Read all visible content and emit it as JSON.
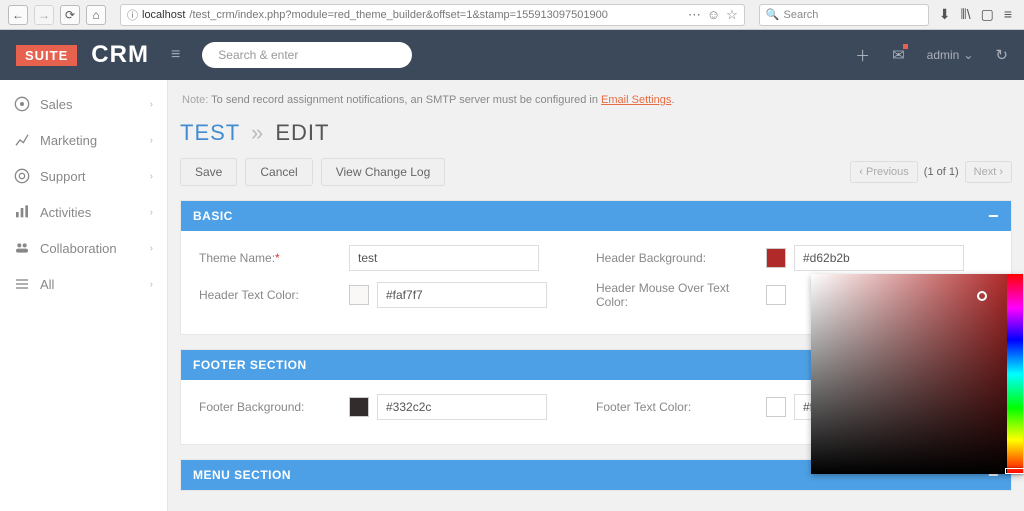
{
  "browser": {
    "url_host": "localhost",
    "url_path": "/test_crm/index.php?module=red_theme_builder&offset=1&stamp=155913097501900",
    "search_placeholder": "Search"
  },
  "header": {
    "logo_left": "SUITE",
    "logo_right": "CRM",
    "search_placeholder": "Search & enter",
    "user": "admin"
  },
  "sidebar": {
    "items": [
      {
        "label": "Sales",
        "icon": "circle-dot"
      },
      {
        "label": "Marketing",
        "icon": "chart"
      },
      {
        "label": "Support",
        "icon": "life-ring"
      },
      {
        "label": "Activities",
        "icon": "bar"
      },
      {
        "label": "Collaboration",
        "icon": "group"
      },
      {
        "label": "All",
        "icon": "list"
      }
    ]
  },
  "note": {
    "prefix": "Note: ",
    "text": "To send record assignment notifications, an SMTP server must be configured in ",
    "link": "Email Settings"
  },
  "pageTitle": {
    "name": "TEST",
    "separator": "»",
    "mode": "EDIT"
  },
  "actions": {
    "save": "Save",
    "cancel": "Cancel",
    "changelog": "View Change Log",
    "prev": "Previous",
    "count": "(1 of 1)",
    "next": "Next"
  },
  "panels": {
    "basic": {
      "title": "BASIC",
      "theme_name_lbl": "Theme Name:",
      "theme_name_val": "test",
      "header_bg_lbl": "Header Background:",
      "header_bg_val": "#d62b2b",
      "header_text_lbl": "Header Text Color:",
      "header_text_val": "#faf7f7",
      "header_text_swatch": "#faf7f7",
      "header_mouse_lbl": "Header Mouse Over Text Color:",
      "header_mouse_val": ""
    },
    "footer": {
      "title": "FOOTER SECTION",
      "bg_lbl": "Footer Background:",
      "bg_val": "#332c2c",
      "bg_swatch": "#332c2c",
      "text_lbl": "Footer Text Color:",
      "text_val": "#ffffff",
      "text_swatch": "#ffffff"
    },
    "menu": {
      "title": "MENU SECTION"
    }
  },
  "swatches": {
    "header_bg": "#b12a2a"
  }
}
